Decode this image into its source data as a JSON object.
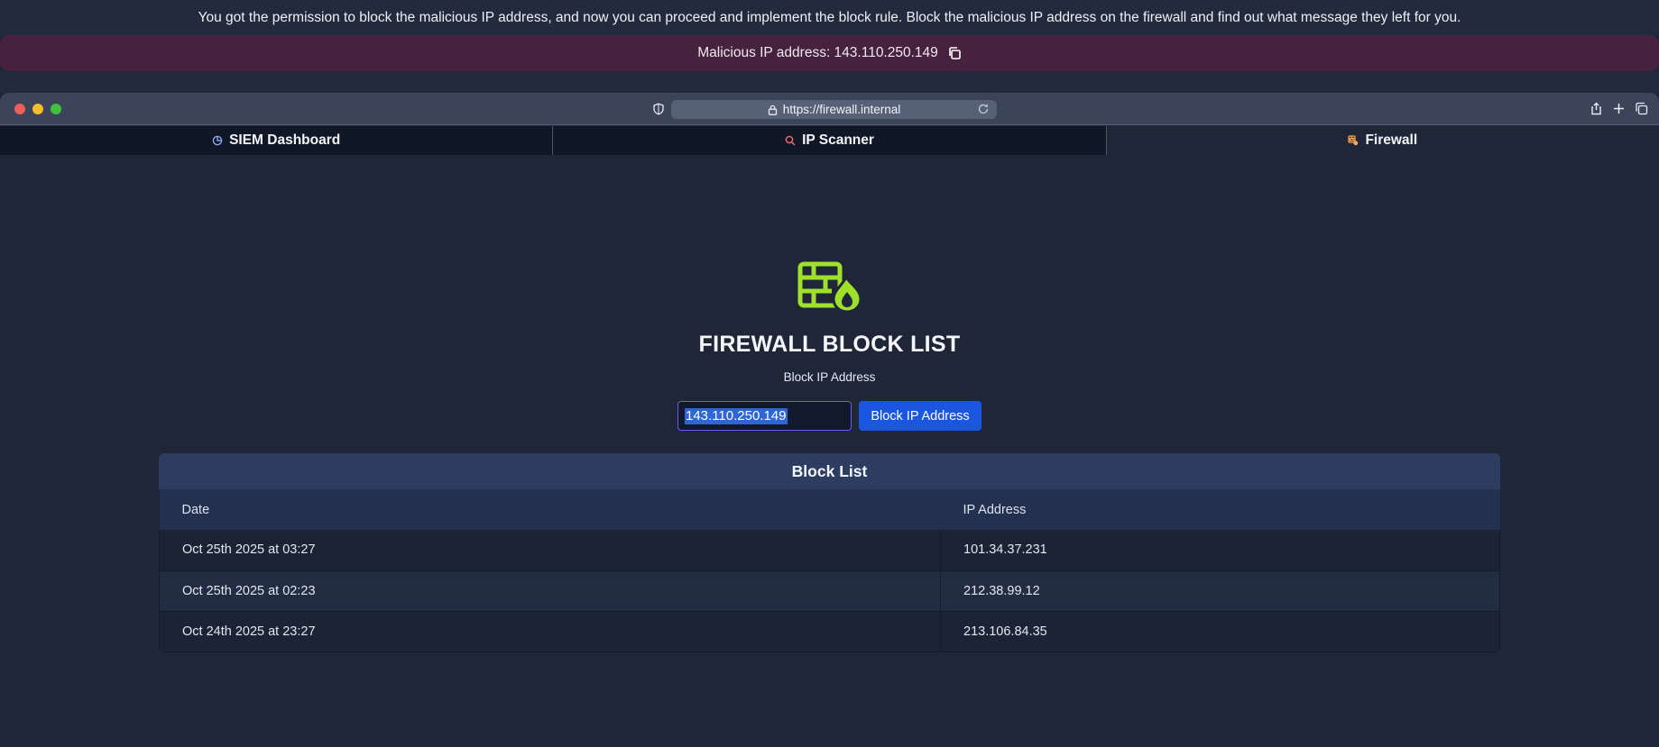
{
  "instructions": "You got the permission to block the malicious IP address, and now you can proceed and implement the block rule. Block the malicious IP address on the firewall and find out what message they left for you.",
  "banner": {
    "text": "Malicious IP address: 143.110.250.149",
    "icon": "copy-icon"
  },
  "browser": {
    "url": "https://firewall.internal"
  },
  "tabs": [
    {
      "label": "SIEM Dashboard",
      "icon": "dashboard-icon",
      "icon_color": "#8fb0ff",
      "active": false
    },
    {
      "label": "IP Scanner",
      "icon": "search-icon",
      "icon_color": "#ff6b6b",
      "active": false
    },
    {
      "label": "Firewall",
      "icon": "firewall-icon",
      "icon_color": "#ffa94d",
      "active": true
    }
  ],
  "firewall": {
    "title": "FIREWALL BLOCK LIST",
    "subtitle": "Block IP Address",
    "input_value": "143.110.250.149",
    "button_label": "Block IP Address",
    "logo_color": "#9fe02a"
  },
  "block_list": {
    "title": "Block List",
    "headers": [
      "Date",
      "IP Address"
    ],
    "rows": [
      {
        "date": "Oct 25th 2025 at 03:27",
        "ip": "101.34.37.231"
      },
      {
        "date": "Oct 25th 2025 at 02:23",
        "ip": "212.38.99.12"
      },
      {
        "date": "Oct 24th 2025 at 23:27",
        "ip": "213.106.84.35"
      }
    ]
  },
  "colors": {
    "accent_button": "#1b56e0",
    "banner_bg": "#46223f",
    "page_bg": "#1e2638"
  }
}
